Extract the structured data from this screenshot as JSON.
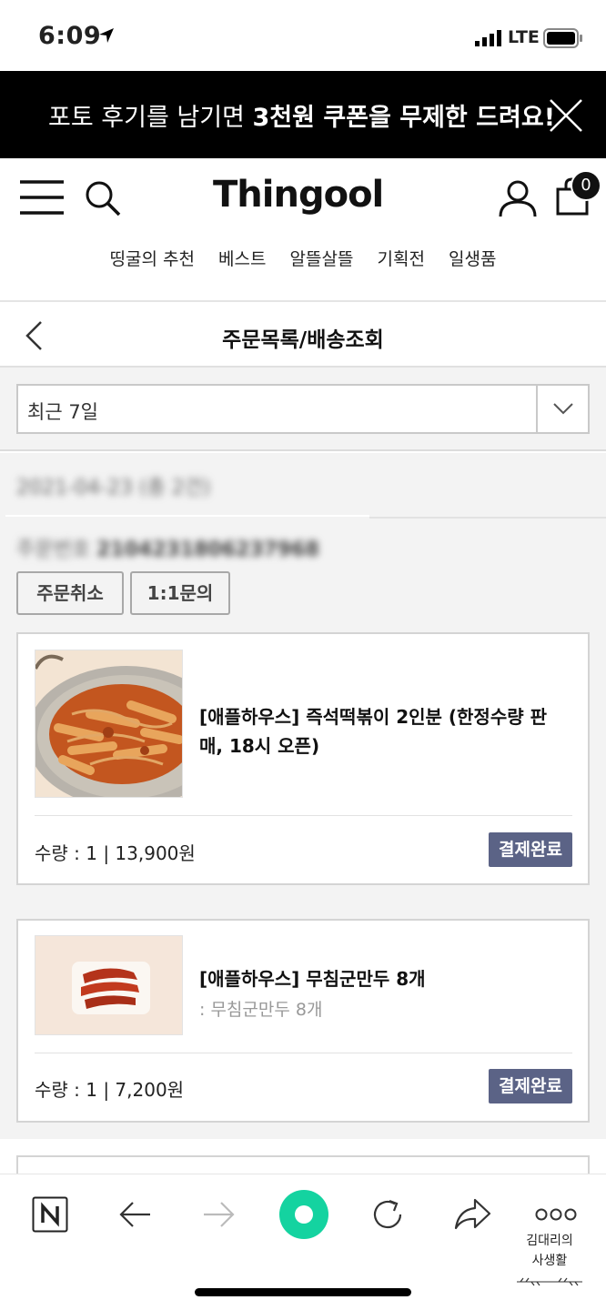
{
  "status_bar": {
    "time": "6:09",
    "network": "LTE"
  },
  "promo": {
    "text_prefix": "포토 후기를 남기면 ",
    "text_bold": "3천원 쿠폰을 무제한 드려요!"
  },
  "header": {
    "logo": "Thingool",
    "cart_count": "0",
    "nav": [
      "띵굴의 추천",
      "베스트",
      "알뜰살뜰",
      "기획전",
      "일생품"
    ]
  },
  "page": {
    "title": "주문목록/배송조회"
  },
  "filter": {
    "period": "최근 7일"
  },
  "order": {
    "date_line": "2021-04-23 (총 2건)",
    "number_label": "주문번호",
    "number": "2104231806237968",
    "cancel_label": "주문취소",
    "inquiry_label": "1:1문의",
    "items": [
      {
        "name": "[애플하우스] 즉석떡볶이 2인분 (한정수량 판매, 18시 오픈)",
        "option": "",
        "quantity": "수량 : 1 | 13,900원",
        "status": "결제완료"
      },
      {
        "name": "[애플하우스] 무침군만두 8개",
        "option": ": 무침군만두 8개",
        "quantity": "수량 : 1 | 7,200원",
        "status": "결제완료"
      }
    ]
  },
  "browser": {
    "blog_label_1": "김대리의",
    "blog_label_2": "사생활"
  },
  "colors": {
    "badge": "#5b6386",
    "accent_green": "#14d3a0",
    "banner": "#000000"
  }
}
